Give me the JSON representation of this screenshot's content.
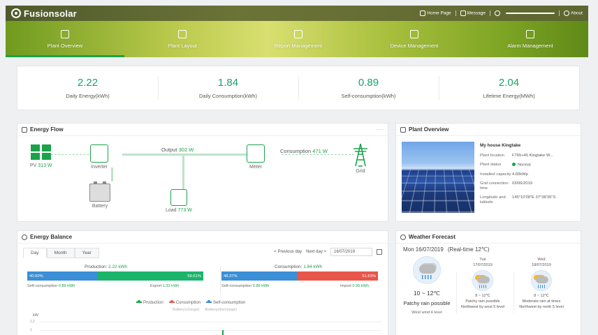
{
  "header": {
    "brand": "Fusionsolar",
    "links": {
      "home": "Home Page",
      "message": "Message",
      "about": "About"
    }
  },
  "nav": [
    {
      "label": "Plant Overview",
      "icon": "house-icon",
      "active": true
    },
    {
      "label": "Plant Layout",
      "icon": "layout-icon",
      "active": false
    },
    {
      "label": "Report Management",
      "icon": "report-icon",
      "active": false
    },
    {
      "label": "Device Management",
      "icon": "device-icon",
      "active": false
    },
    {
      "label": "Alarm Management",
      "icon": "alarm-monitor-icon",
      "active": false
    }
  ],
  "kpi": [
    {
      "value": "2.22",
      "label": "Daily Energy(kWh)"
    },
    {
      "value": "1.84",
      "label": "Daily Consumption(kWh)"
    },
    {
      "value": "0.89",
      "label": "Self-consumption(kWh)"
    },
    {
      "value": "2.04",
      "label": "Lifetime Energy(MWh)"
    }
  ],
  "energy_flow": {
    "title": "Energy Flow",
    "more": "···",
    "output_label": "Output",
    "output_value": "302 W",
    "consumption_label": "Consumption",
    "consumption_value": "471 W",
    "pv_label": "PV",
    "pv_value": "313 W",
    "inverter_label": "Inverter",
    "meter_label": "Meter",
    "grid_label": "Grid",
    "battery_label": "Battery",
    "load_label": "Load",
    "load_value": "773 W"
  },
  "plant_overview": {
    "title": "Plant Overview",
    "name": "My house Kingtake",
    "rows": [
      {
        "k": "Plant location",
        "v": "F765+45 Kingtake W..."
      },
      {
        "k": "Plant status",
        "v": "Normal"
      },
      {
        "k": "Installed capacity",
        "v": "4.60kWp"
      },
      {
        "k": "Grid connection time",
        "v": "03/06/2019"
      },
      {
        "k": "Longitude and latitude",
        "v": "145°10'28\"E 37°38'35\"S"
      }
    ]
  },
  "energy_balance": {
    "title": "Energy Balance",
    "tabs": [
      "Day",
      "Month",
      "Year"
    ],
    "prev": "< Previous day",
    "next": "Next day >",
    "date": "16/07/2019",
    "production_label": "Production:",
    "production_value": "2.22 kWh",
    "production_left_pct": "40.00%",
    "production_right_pct": "59.61%",
    "production_left_frac": 0.4,
    "self_consumption_label": "Self-consumption",
    "self_consumption_value": "0.89 kWh",
    "export_label": "Export",
    "export_value": "1.33 kWh",
    "consumption_label": "Consumption:",
    "consumption_value": "1.84 kWh",
    "consumption_left_pct": "48.37%",
    "consumption_right_pct": "51.63%",
    "consumption_left_frac": 0.4837,
    "self_consumption2_value": "0.89 kWh",
    "import_label": "Import",
    "import_value": "0.95 kWh",
    "legend": [
      "Production",
      "Consumption",
      "Self-consumption"
    ],
    "legend2": [
      "Battery(charge)",
      "Battery(discharge)"
    ],
    "y_unit": "kW",
    "y_ticks": [
      "1.2",
      "1"
    ]
  },
  "weather": {
    "title": "Weather Forecast",
    "date": "Mon 16/07/2019",
    "realtime": "(Real-time 12℃)",
    "today": {
      "temp": "10 ~ 12℃",
      "desc": "Patchy rain possible",
      "wind": "West wind 4 level"
    },
    "days": [
      {
        "day": "Tue",
        "date": "17/07/2019",
        "temp": "8 ~ 12℃",
        "desc": "Patchy rain possible",
        "wind": "Northwest by west 5 level"
      },
      {
        "day": "Wed",
        "date": "18/07/2019",
        "temp": "8 ~ 12℃",
        "desc": "Moderate rain at times",
        "wind": "Northwest by north 5 level"
      }
    ]
  },
  "colors": {
    "accent": "#1aa34a",
    "blue": "#3a8fd6",
    "red": "#e8564a",
    "kpi": "#1aa36a"
  }
}
